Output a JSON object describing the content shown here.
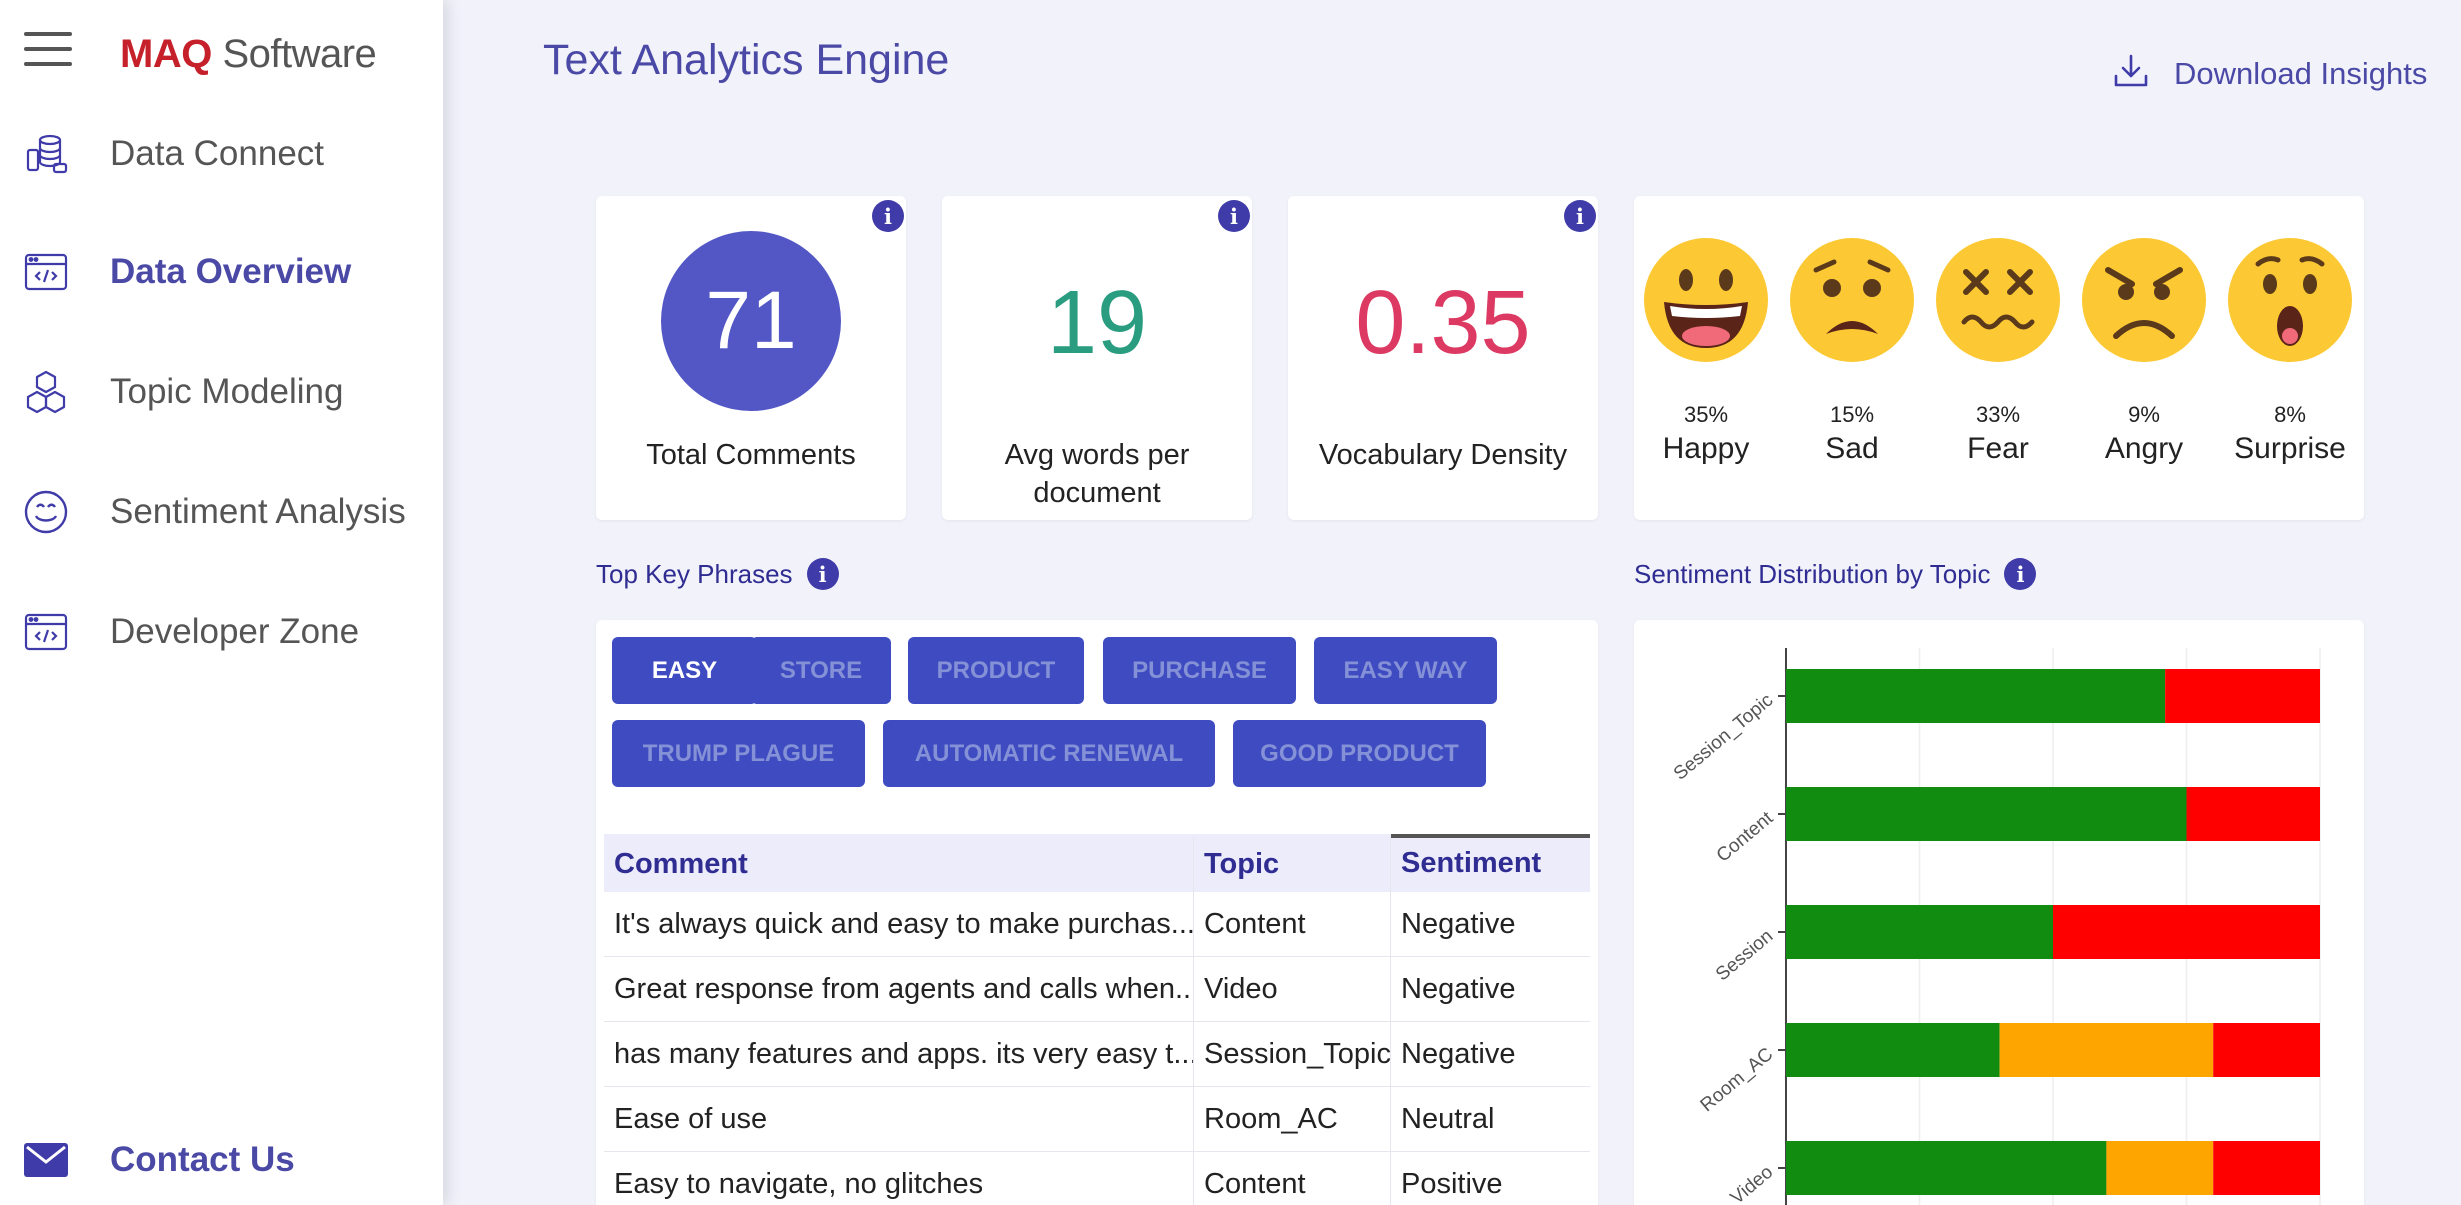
{
  "sidebar": {
    "brand_primary": "MAQ",
    "brand_secondary": " Software",
    "items": [
      {
        "label": "Data Connect",
        "icon": "database-icon"
      },
      {
        "label": "Data Overview",
        "icon": "code-window-icon"
      },
      {
        "label": "Topic Modeling",
        "icon": "cubes-icon"
      },
      {
        "label": "Sentiment Analysis",
        "icon": "smile-icon"
      },
      {
        "label": "Developer Zone",
        "icon": "code-window-icon"
      }
    ],
    "active_index": 1,
    "contact_label": "Contact Us"
  },
  "header": {
    "title": "Text Analytics Engine",
    "download_label": "Download Insights"
  },
  "stats": {
    "total_comments": {
      "value": "71",
      "label": "Total Comments"
    },
    "avg_words": {
      "value": "19",
      "label_line1": "Avg words per",
      "label_line2": "document"
    },
    "vocab_density": {
      "value": "0.35",
      "label": "Vocabulary Density"
    }
  },
  "emotions": [
    {
      "pct": "35%",
      "name": "Happy",
      "icon": "happy-face-icon"
    },
    {
      "pct": "15%",
      "name": "Sad",
      "icon": "sad-face-icon"
    },
    {
      "pct": "33%",
      "name": "Fear",
      "icon": "fear-face-icon"
    },
    {
      "pct": "9%",
      "name": "Angry",
      "icon": "angry-face-icon"
    },
    {
      "pct": "8%",
      "name": "Surprise",
      "icon": "surprise-face-icon"
    }
  ],
  "key_phrases": {
    "title": "Top Key Phrases",
    "phrases": [
      "EASY",
      "STORE",
      "PRODUCT",
      "PURCHASE",
      "EASY WAY",
      "TRUMP PLAGUE",
      "AUTOMATIC RENEWAL",
      "GOOD PRODUCT"
    ],
    "active_index": 0
  },
  "table": {
    "headers": [
      "Comment",
      "Topic",
      "Sentiment"
    ],
    "rows": [
      [
        "It's always quick and easy to make purchas...",
        "Content",
        "Negative"
      ],
      [
        "Great response from agents and calls when...",
        "Video",
        "Negative"
      ],
      [
        "has many features and apps. its very easy t...",
        "Session_Topic",
        "Negative"
      ],
      [
        "Ease of use",
        "Room_AC",
        "Neutral"
      ],
      [
        "Easy to navigate, no glitches",
        "Content",
        "Positive"
      ]
    ]
  },
  "sentiment_chart": {
    "title": "Sentiment Distribution by Topic"
  },
  "chart_data": {
    "type": "bar",
    "orientation": "horizontal",
    "stacked": true,
    "categories": [
      "Session_Topic",
      "Content",
      "Session",
      "Room_AC",
      "Video"
    ],
    "series": [
      {
        "color": "#118c11",
        "values": [
          71,
          75,
          50,
          40,
          60
        ]
      },
      {
        "color": "#ffa500",
        "values": [
          0,
          0,
          0,
          40,
          20
        ]
      },
      {
        "color": "#ff0000",
        "values": [
          29,
          25,
          50,
          20,
          20
        ]
      }
    ],
    "xlim": [
      0,
      100
    ],
    "grid": true
  },
  "colors": {
    "accent": "#4b49a6",
    "stat_blue": "#5357c5",
    "stat_green": "#2a9d80",
    "stat_red": "#dc3a63"
  }
}
